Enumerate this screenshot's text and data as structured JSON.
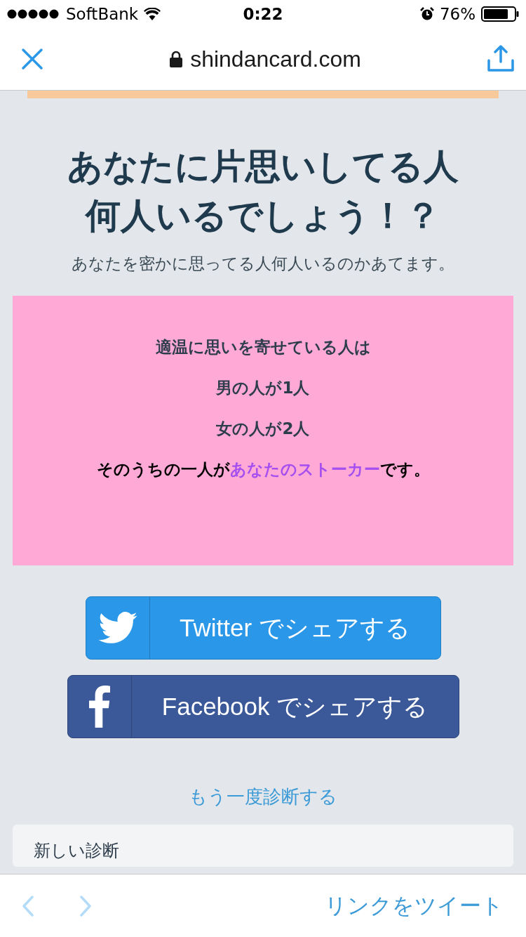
{
  "status_bar": {
    "carrier": "SoftBank",
    "time": "0:22",
    "battery": "76%"
  },
  "browser_bar": {
    "url": "shindancard.com"
  },
  "page": {
    "title_lines": [
      "あなたに片思いしてる人",
      "何人いるでしょう！？"
    ],
    "subtitle": "あなたを密かに思ってる人何人いるのかあてます。",
    "result_lines": [
      "適温に思いを寄せている人は",
      "男の人が1人",
      "女の人が2人"
    ],
    "result_conclusion": "**そのうちの一人が**あなたのストーカー**です。**",
    "share_buttons": [
      {
        "kind": "twitter",
        "label": "Twitter でシェアする"
      },
      {
        "kind": "facebook",
        "label": "Facebook でシェアする"
      }
    ],
    "retry_link": "もう一度診断する",
    "new_section_title": "新しい診断"
  },
  "bottom_bar": {
    "back": {
      "disabled": true
    },
    "forward": {
      "disabled": true
    },
    "action": "リンクをツイート"
  }
}
